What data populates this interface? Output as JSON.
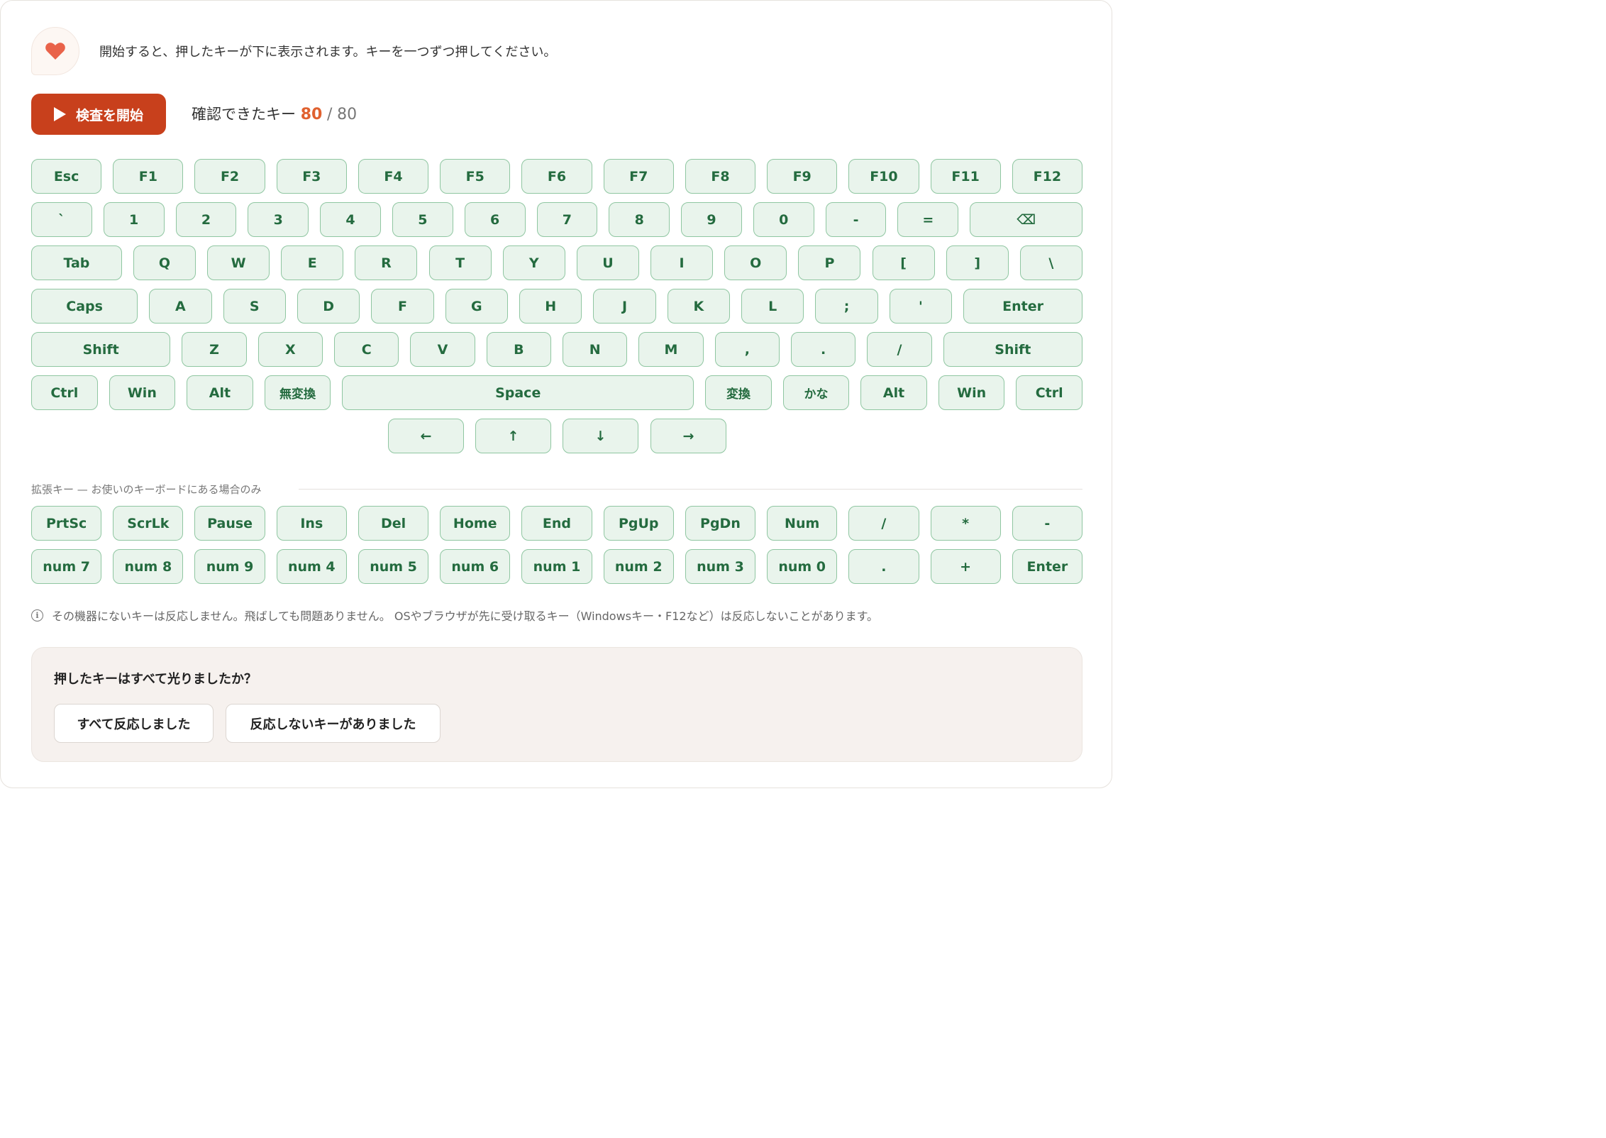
{
  "intro": {
    "icon": "heart-icon",
    "icon_color": "#e9634a",
    "text": "開始すると、押したキーが下に表示されます。キーを一つずつ押してください。"
  },
  "controls": {
    "start_label": "検査を開始",
    "start_color": "#c8401c",
    "confirmed_label": "確認できたキー",
    "confirmed_count": "80",
    "separator": "/",
    "total": "80"
  },
  "keyboard": {
    "row_function": [
      "Esc",
      "F1",
      "F2",
      "F3",
      "F4",
      "F5",
      "F6",
      "F7",
      "F8",
      "F9",
      "F10",
      "F11",
      "F12"
    ],
    "row_number": [
      "`",
      "1",
      "2",
      "3",
      "4",
      "5",
      "6",
      "7",
      "8",
      "9",
      "0",
      "-",
      "=",
      "⌫"
    ],
    "row_qwerty": [
      "Tab",
      "Q",
      "W",
      "E",
      "R",
      "T",
      "Y",
      "U",
      "I",
      "O",
      "P",
      "[",
      "]",
      "\\"
    ],
    "row_home": [
      "Caps",
      "A",
      "S",
      "D",
      "F",
      "G",
      "H",
      "J",
      "K",
      "L",
      ";",
      "'",
      "Enter"
    ],
    "row_shift": [
      "Shift",
      "Z",
      "X",
      "C",
      "V",
      "B",
      "N",
      "M",
      ",",
      ".",
      "/",
      "Shift"
    ],
    "row_bottom": [
      "Ctrl",
      "Win",
      "Alt",
      "無変換",
      "Space",
      "変換",
      "かな",
      "Alt",
      "Win",
      "Ctrl"
    ],
    "row_arrows": [
      "←",
      "↑",
      "↓",
      "→"
    ],
    "key_color": "#e9f4ec",
    "key_border": "#8fc6a1",
    "key_text_color": "#246b3f"
  },
  "extended": {
    "heading": "拡張キー — お使いのキーボードにある場合のみ",
    "row_nav": [
      "PrtSc",
      "ScrLk",
      "Pause",
      "Ins",
      "Del",
      "Home",
      "End",
      "PgUp",
      "PgDn",
      "Num",
      "/",
      "*",
      "-"
    ],
    "row_numpad": [
      "num 7",
      "num 8",
      "num 9",
      "num 4",
      "num 5",
      "num 6",
      "num 1",
      "num 2",
      "num 3",
      "num 0",
      ".",
      "+",
      "Enter"
    ]
  },
  "note": {
    "icon": "info-icon",
    "text": "その機器にないキーは反応しません。飛ばしても問題ありません。 OSやブラウザが先に受け取るキー（Windowsキー・F12など）は反応しないことがあります。"
  },
  "question": {
    "title": "押したキーはすべて光りましたか？",
    "all_ok_label": "すべて反応しました",
    "some_failed_label": "反応しないキーがありました"
  }
}
